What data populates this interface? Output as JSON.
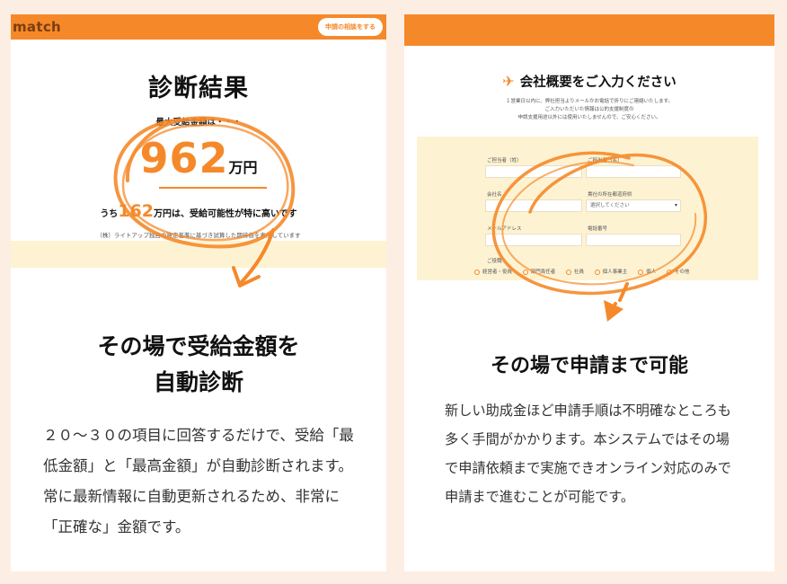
{
  "left_card": {
    "brand": "match",
    "header_button": "申請の相談をする",
    "result_title": "診断結果",
    "max_label": "最大受給金額は・・・",
    "amount": "962",
    "amount_unit": "万円",
    "sub_prefix": "うち",
    "sub_amount": "162",
    "sub_suffix": "万円は、受給可能性が特に高いです",
    "note": "（株）ライトアップ独自の算定基準に基づき試算した期待値を表示しています",
    "heading_line1": "その場で受給金額を",
    "heading_line2": "自動診断",
    "body": "２０〜３０の項目に回答するだけで、受給「最低金額」と「最高金額」が自動診断されます。常に最新情報に自動更新されるため、非常に「正確な」金額です。"
  },
  "right_card": {
    "form_title": "会社概要をご入力ください",
    "intro_line1": "１営業日以内に、弊社担当よりメールかお電話で折りにご連絡いたします。",
    "intro_line2": "ご入力いただいた情報は公的支援制度の",
    "intro_line3": "申請支援用途以外には使用いたしませんので、ご安心ください。",
    "form": {
      "last_name_label": "ご担当者（姓）",
      "first_name_label": "ご担当者（名）",
      "company_label": "会社名",
      "prefecture_label": "貴社の所在都道府県",
      "prefecture_value": "選択してください",
      "email_label": "メールアドレス",
      "phone_label": "電話番号",
      "role_label": "ご役職",
      "roles": [
        "経営者・役員",
        "部門責任者",
        "社員",
        "個人事業主",
        "個人",
        "その他"
      ]
    },
    "heading": "その場で申請まで可能",
    "body": "新しい助成金ほど申請手順は不明確なところも多く手間がかかります。本システムではその場で申請依頼まで実施できオンライン対応のみで申請まで進むことが可能です。"
  },
  "colors": {
    "accent": "#f5892a",
    "background": "#fdeee3",
    "cream": "#fdf3d3"
  },
  "icons": {
    "plane": "paper-plane-icon",
    "arrow": "arrow-down-icon"
  }
}
